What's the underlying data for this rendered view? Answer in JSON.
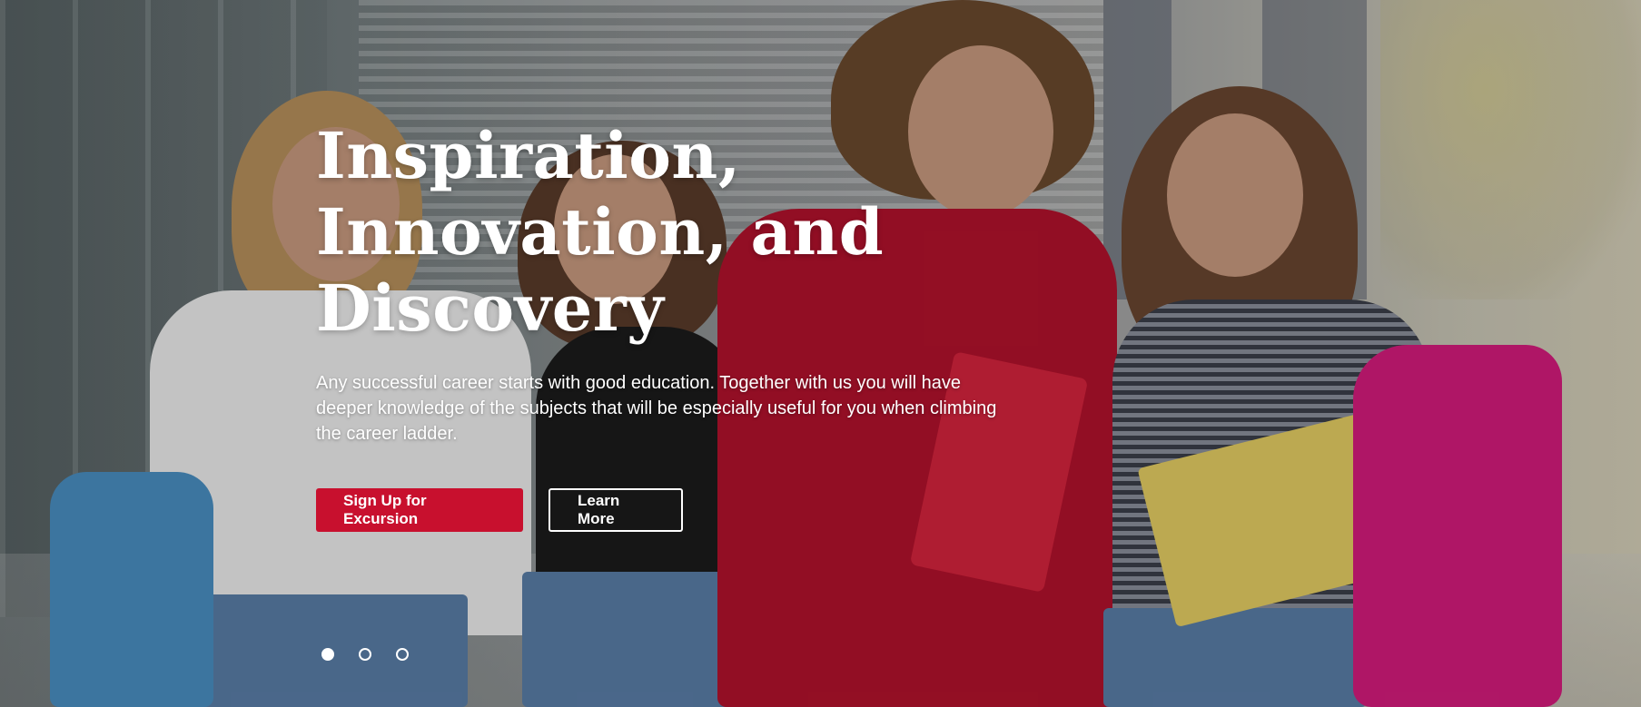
{
  "hero": {
    "headline_lines": [
      "Inspiration,",
      "Innovation, and",
      "Discovery"
    ],
    "subtext": "Any successful career starts with good education. Together with us you will have deeper knowledge of the subjects that will be especially useful for you when climbing the career ladder.",
    "primary_button_label": "Sign Up for Excursion",
    "secondary_button_label": "Learn More",
    "slides": {
      "count": 3,
      "active_index": 0
    },
    "background_image": "four-students-walking-with-backpacks-and-books"
  },
  "colors": {
    "accent": "#c8102e",
    "text": "#ffffff"
  }
}
